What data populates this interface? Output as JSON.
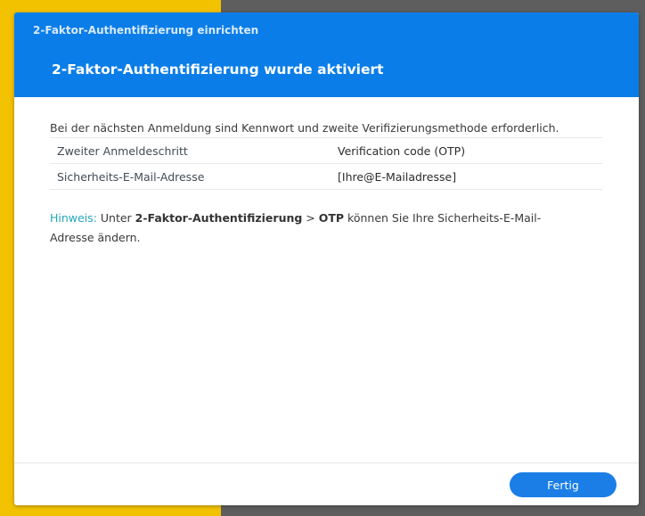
{
  "colors": {
    "header_bg": "#0a7de8",
    "desktop_left": "#f2c200",
    "desktop_right": "#5e5e5e",
    "hint_label": "#23a6b8",
    "primary_button": "#1b7ee6"
  },
  "window": {
    "title": "2-Faktor-Authentifizierung einrichten",
    "step_title": "2-Faktor-Authentifizierung wurde aktiviert"
  },
  "content": {
    "intro": "Bei der nächsten Anmeldung sind Kennwort und zweite Verifizierungsmethode erforderlich.",
    "summary_rows": [
      {
        "label": "Zweiter Anmeldeschritt",
        "value": "Verification code (OTP)"
      },
      {
        "label": "Sicherheits-E-Mail-Adresse",
        "value": "[Ihre@E-Mailadresse]"
      }
    ],
    "hint": {
      "label": "Hinweis:",
      "text_1": " Unter ",
      "bold_1": "2-Faktor-Authentifizierung",
      "text_2": " > ",
      "bold_2": "OTP",
      "text_3": " können Sie Ihre Sicherheits-E-Mail-Adresse ändern."
    }
  },
  "footer": {
    "done_label": "Fertig"
  }
}
